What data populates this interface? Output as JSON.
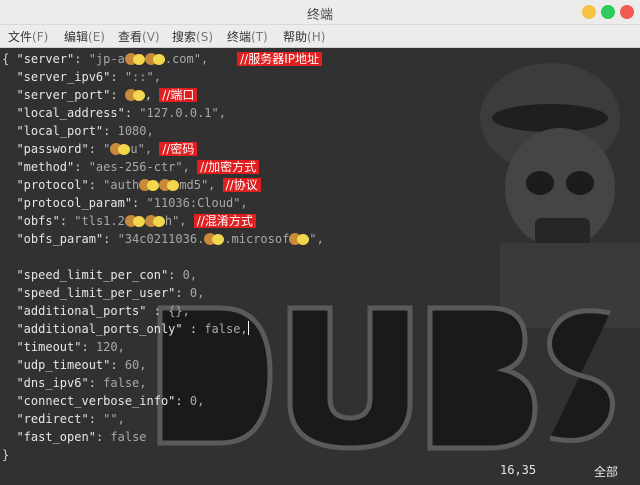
{
  "window": {
    "title": "终端",
    "colors": {
      "minimize": "#f5c343",
      "maximize": "#2ecc5f",
      "close": "#f05a4f"
    }
  },
  "menu": [
    {
      "label": "文件",
      "mnemonic": "(F)"
    },
    {
      "label": "编辑",
      "mnemonic": "(E)"
    },
    {
      "label": "查看",
      "mnemonic": "(V)"
    },
    {
      "label": "搜索",
      "mnemonic": "(S)"
    },
    {
      "label": "终端",
      "mnemonic": "(T)"
    },
    {
      "label": "帮助",
      "mnemonic": "(H)"
    }
  ],
  "code": {
    "open_brace": "{",
    "close_brace": "}",
    "lines": [
      {
        "key": "\"server\"",
        "value": "\"jp-a",
        "value_tail": ".com\",",
        "comment": "//服务器IP地址"
      },
      {
        "key": "\"server_ipv6\"",
        "value": "\"::\","
      },
      {
        "key": "\"server_port\"",
        "value": "",
        "value_tail": ",",
        "comment": "//端口"
      },
      {
        "key": "\"local_address\"",
        "value": "\"127.0.0.1\","
      },
      {
        "key": "\"local_port\"",
        "value": "1080,"
      },
      {
        "key": "\"password\"",
        "value": "\"",
        "value_tail": "u\",",
        "comment": "//密码"
      },
      {
        "key": "\"method\"",
        "value": "\"aes-256-ctr\",",
        "comment": "//加密方式"
      },
      {
        "key": "\"protocol\"",
        "value": "\"auth",
        "value_tail": "md5\",",
        "comment": "//协议"
      },
      {
        "key": "\"protocol_param\"",
        "value": "\"11036:Cloud\","
      },
      {
        "key": "\"obfs\"",
        "value": "\"tls1.2",
        "value_tail": "h\",",
        "comment": "//混淆方式"
      },
      {
        "key": "\"obfs_param\"",
        "value": "\"34c0211036.",
        "value_tail": ".microsof",
        "value_end": "\","
      },
      {
        "key": "",
        "value": ""
      },
      {
        "key": "\"speed_limit_per_con\"",
        "value": "0,"
      },
      {
        "key": "\"speed_limit_per_user\"",
        "value": "0,"
      },
      {
        "key": "\"additional_ports\"",
        "value": "{},"
      },
      {
        "key": "\"additional_ports_only\"",
        "value": "false,"
      },
      {
        "key": "\"timeout\"",
        "value": "120,"
      },
      {
        "key": "\"udp_timeout\"",
        "value": "60,"
      },
      {
        "key": "\"dns_ipv6\"",
        "value": "false,"
      },
      {
        "key": "\"connect_verbose_info\"",
        "value": "0,"
      },
      {
        "key": "\"redirect\"",
        "value": "\"\","
      },
      {
        "key": "\"fast_open\"",
        "value": "false"
      }
    ]
  },
  "status": {
    "position": "16,35",
    "scope": "全部"
  },
  "accent": {
    "comment_bg": "#e02020"
  }
}
